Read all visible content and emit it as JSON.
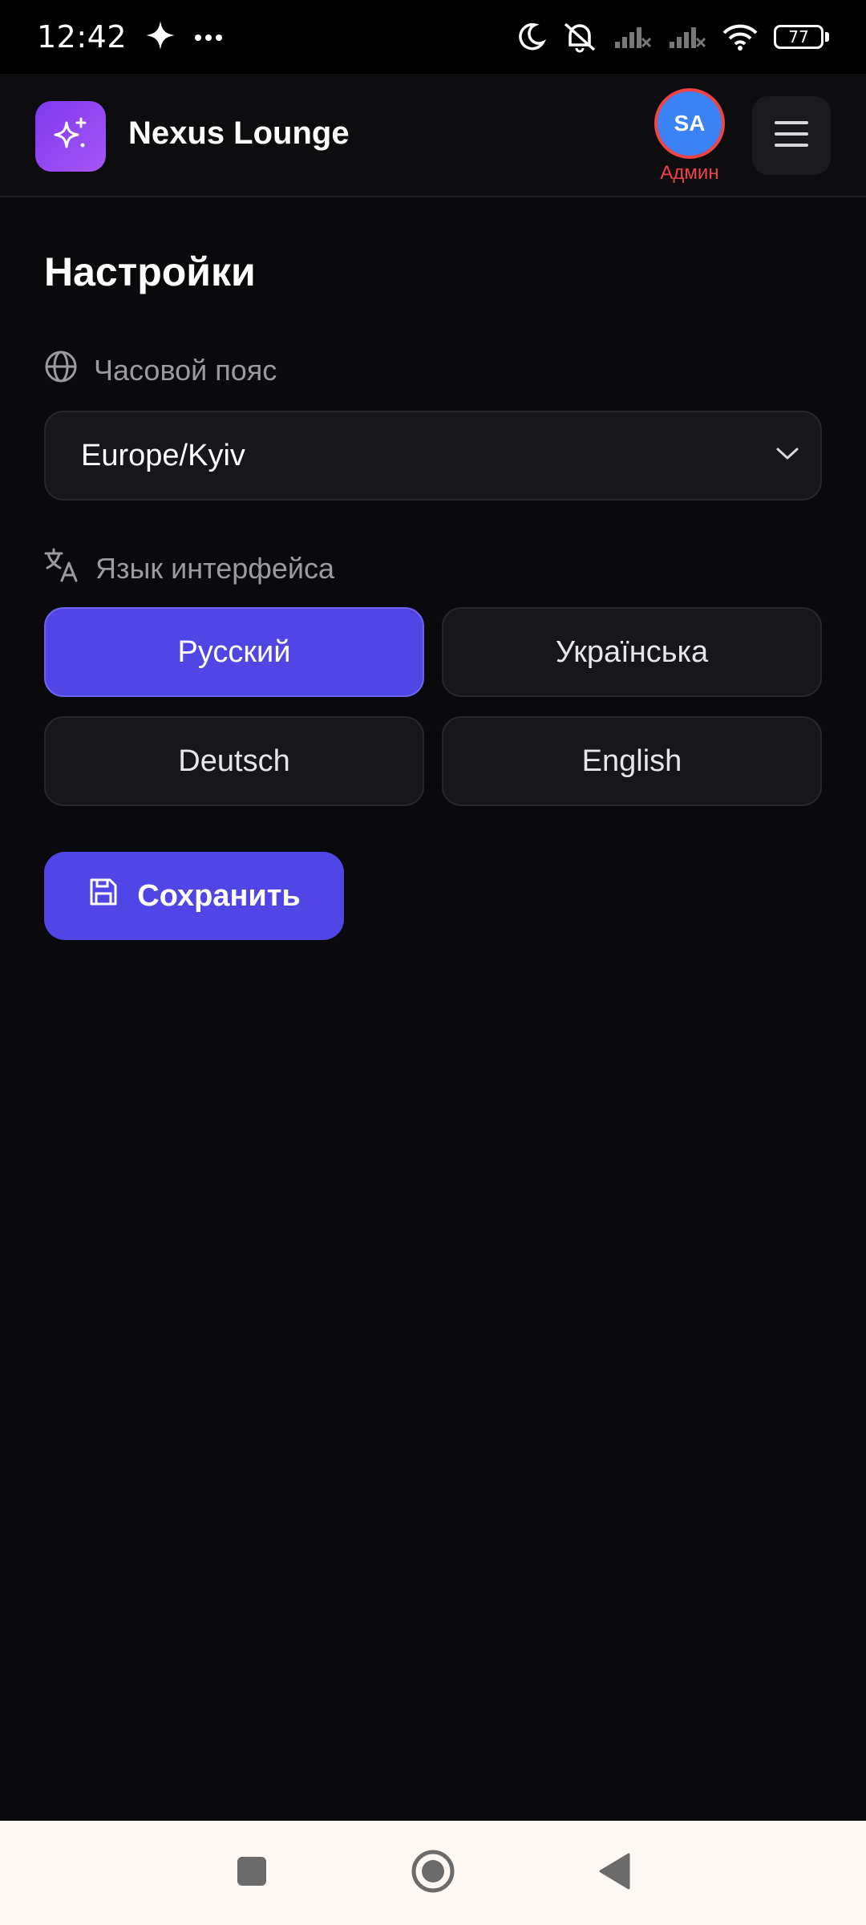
{
  "status_bar": {
    "time": "12:42",
    "battery": "77",
    "icons": [
      "sparkle-icon",
      "more-dots-icon",
      "moon-icon",
      "silent-alarm-icon",
      "signal-icon",
      "signal-icon",
      "wifi-icon",
      "battery-icon"
    ]
  },
  "header": {
    "app_name": "Nexus Lounge",
    "logo_icon": "sparkles-icon",
    "avatar_initials": "SA",
    "avatar_role": "Админ",
    "menu_icon": "hamburger-menu-icon"
  },
  "settings": {
    "title": "Настройки",
    "timezone": {
      "label": "Часовой пояс",
      "icon": "globe-icon",
      "value": "Europe/Kyiv"
    },
    "language": {
      "label": "Язык интерфейса",
      "icon": "translate-icon",
      "options": [
        "Русский",
        "Українська",
        "Deutsch",
        "English"
      ],
      "selected": "Русский"
    },
    "save_label": "Сохранить",
    "save_icon": "floppy-disk-icon"
  },
  "colors": {
    "accent": "#5046e5",
    "background": "#0a0a0c",
    "avatar": "#3b82f6",
    "admin_red": "#ef4444",
    "logo_gradient_start": "#7c3aed",
    "logo_gradient_end": "#a855f7"
  },
  "nav_bar": {
    "icons": [
      "recents-square-icon",
      "home-circle-icon",
      "back-triangle-icon"
    ]
  }
}
